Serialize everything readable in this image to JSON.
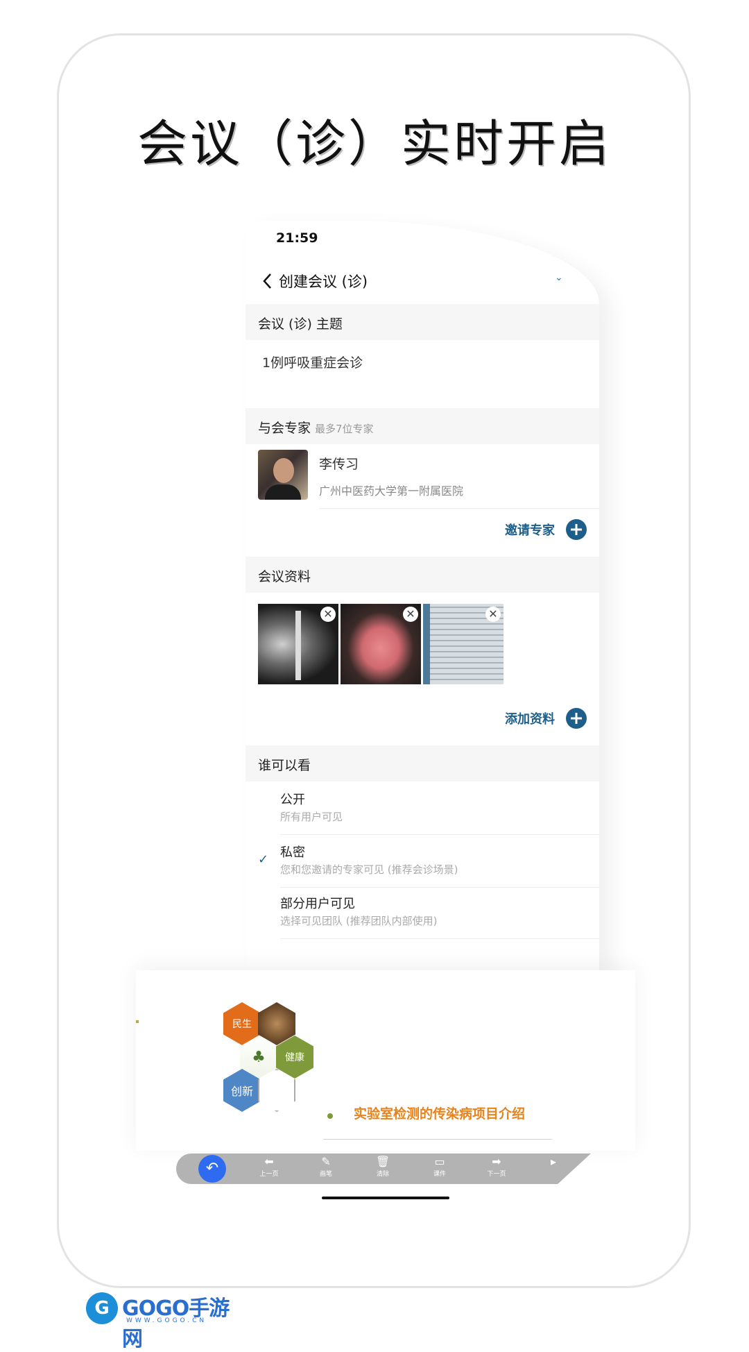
{
  "headline": "会议（诊）实时开启",
  "status_bar": {
    "time": "21:59"
  },
  "nav": {
    "title": "创建会议 (诊)"
  },
  "topic_section": {
    "header": "会议 (诊) 主题",
    "value": "1例呼吸重症会诊"
  },
  "experts_section": {
    "header": "与会专家",
    "hint": "最多7位专家",
    "experts": [
      {
        "name": "李传习",
        "hospital": "广州中医药大学第一附属医院"
      }
    ],
    "invite_label": "邀请专家"
  },
  "materials_section": {
    "header": "会议资料",
    "items": [
      {
        "kind": "chest-xray"
      },
      {
        "kind": "tongue-photo"
      },
      {
        "kind": "handwritten-record"
      }
    ],
    "add_label": "添加资料"
  },
  "visibility_section": {
    "header": "谁可以看",
    "options": [
      {
        "title": "公开",
        "desc": "所有用户可见",
        "selected": false
      },
      {
        "title": "私密",
        "desc": "您和您邀请的专家可见 (推荐会诊场景)",
        "selected": true
      },
      {
        "title": "部分用户可见",
        "desc": "选择可见团队 (推荐团队内部使用)",
        "selected": false
      }
    ]
  },
  "slide": {
    "hex_labels": [
      "民生",
      "健康",
      "创新"
    ],
    "title": "实验室检测的传染病项目介绍"
  },
  "toolbar": {
    "items": [
      {
        "icon": "arrow-left-icon",
        "label": "上一页"
      },
      {
        "icon": "pen-icon",
        "label": "画笔"
      },
      {
        "icon": "trash-icon",
        "label": "清除"
      },
      {
        "icon": "folder-icon",
        "label": "课件"
      },
      {
        "icon": "arrow-right-icon",
        "label": "下一页"
      }
    ]
  },
  "watermark": {
    "brand": "GOGO手游网",
    "url": "WWW.GOGO.CN"
  },
  "colors": {
    "accent": "#1d5f8a",
    "slide_orange": "#e8821a",
    "toolbar_blue": "#2f6bf0"
  }
}
